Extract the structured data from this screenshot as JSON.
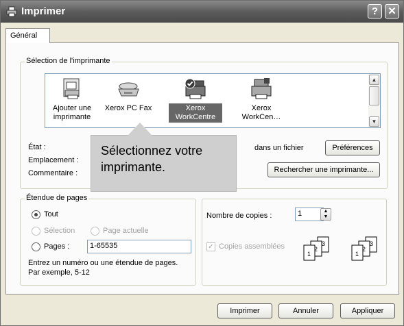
{
  "window": {
    "title": "Imprimer",
    "help_glyph": "?",
    "close_glyph": "✕"
  },
  "tabs": [
    {
      "label": "Général"
    }
  ],
  "printer_selection": {
    "legend": "Sélection de l'imprimante",
    "printers": [
      {
        "label_line1": "Ajouter une",
        "label_line2": "imprimante",
        "icon": "add-printer-icon",
        "selected": false
      },
      {
        "label_line1": "Xerox PC Fax",
        "label_line2": "",
        "icon": "fax-icon",
        "selected": false
      },
      {
        "label_line1": "Xerox",
        "label_line2": "WorkCentre",
        "icon": "printer-default-icon",
        "selected": true
      },
      {
        "label_line1": "Xerox",
        "label_line2": "WorkCen…",
        "icon": "multifunction-printer-icon",
        "selected": false
      }
    ],
    "state_label": "État :",
    "location_label": "Emplacement :",
    "comment_label": "Commentaire :",
    "print_to_file_label": "dans un fichier",
    "preferences_button": "Préférences",
    "find_printer_button": "Rechercher une imprimante..."
  },
  "callout": {
    "line1": "Sélectionnez votre",
    "line2": "imprimante."
  },
  "page_range": {
    "legend": "Étendue de pages",
    "all_label": "Tout",
    "selection_label": "Sélection",
    "current_page_label": "Page actuelle",
    "pages_label": "Pages :",
    "pages_value": "1-65535",
    "hint_line1": "Entrez un numéro ou une étendue de pages.",
    "hint_line2": "Par exemple, 5-12"
  },
  "copies": {
    "copies_label": "Nombre de copies :",
    "copies_value": "1",
    "collate_label": "Copies assemblées",
    "collate_checked": true,
    "stack_numbers": [
      "1",
      "2",
      "3"
    ]
  },
  "footer": {
    "print_button": "Imprimer",
    "cancel_button": "Annuler",
    "apply_button": "Appliquer"
  }
}
